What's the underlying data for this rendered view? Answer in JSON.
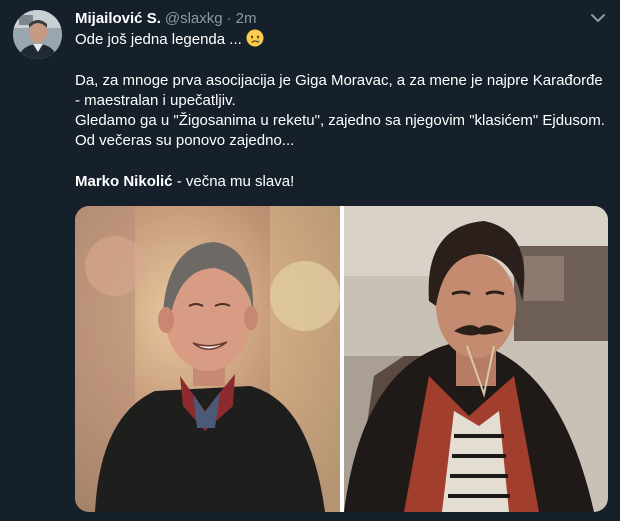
{
  "tweet": {
    "author_name": "Mijailović S.",
    "author_handle": "@slaxkg",
    "separator": "·",
    "timestamp": "2m",
    "line1": "Ode još jedna legenda ...",
    "line1_emoji": "crying-face-icon",
    "para1": "Da, za mnoge prva asocijacija je  Giga Moravac, a za mene je najpre Karađorđe - maestralan i upečatljiv.",
    "para2": "Gledamo ga u \"Žigosanima u reketu\", zajedno sa njegovim \"klasićem\" Ejdusom. Od večeras su ponovo zajedno...",
    "signoff_name": "Marko Nikolić",
    "signoff_rest": " - večna mu slava!",
    "more_icon": "chevron-down-icon"
  },
  "colors": {
    "background": "#15202b",
    "text": "#ffffff",
    "muted": "#8899a6"
  }
}
